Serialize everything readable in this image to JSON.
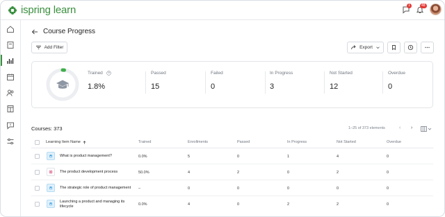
{
  "app": {
    "brand": "ispring learn",
    "brand_color": "#3a8f3f",
    "notifications": {
      "chat_count": "1",
      "bell_count": "48"
    }
  },
  "sidebar": {
    "items": [
      {
        "icon": "home-icon"
      },
      {
        "icon": "book-icon"
      },
      {
        "icon": "reports-icon",
        "active": true
      },
      {
        "icon": "calendar-icon"
      },
      {
        "icon": "users-icon"
      },
      {
        "icon": "document-icon"
      },
      {
        "icon": "message-icon"
      },
      {
        "icon": "settings-sliders-icon"
      }
    ]
  },
  "page": {
    "title": "Course Progress",
    "add_filter": "Add Filter",
    "export": "Export"
  },
  "stats": {
    "trained": {
      "label": "Trained",
      "value": "1.8%",
      "fraction": 0.018
    },
    "passed": {
      "label": "Passed",
      "value": "15"
    },
    "failed": {
      "label": "Failed",
      "value": "0"
    },
    "in_progress": {
      "label": "In Progress",
      "value": "3"
    },
    "not_started": {
      "label": "Not Started",
      "value": "12"
    },
    "overdue": {
      "label": "Overdue",
      "value": "0"
    }
  },
  "courses": {
    "count_label": "Courses: 373",
    "pagination": "1–25 of 373 elements"
  },
  "table": {
    "columns": [
      "Learning Item Name",
      "Trained",
      "Enrollments",
      "Passed",
      "In Progress",
      "Not Started",
      "Overdue"
    ],
    "rows": [
      {
        "name": "What is product management?",
        "trained": "0.0%",
        "enrollments": "5",
        "passed": "0",
        "in_progress": "1",
        "not_started": "4",
        "overdue": "0",
        "thumb": "blue"
      },
      {
        "name": "The product development process",
        "trained": "50.0%",
        "enrollments": "4",
        "passed": "2",
        "in_progress": "0",
        "not_started": "2",
        "overdue": "0",
        "thumb": "white"
      },
      {
        "name": "The strategic role of product management",
        "trained": "–",
        "enrollments": "0",
        "passed": "0",
        "in_progress": "0",
        "not_started": "0",
        "overdue": "0",
        "thumb": "blue"
      },
      {
        "name": "Launching a product and managing its lifecycle",
        "trained": "0.0%",
        "enrollments": "4",
        "passed": "0",
        "in_progress": "2",
        "not_started": "2",
        "overdue": "0",
        "thumb": "blue"
      }
    ]
  }
}
